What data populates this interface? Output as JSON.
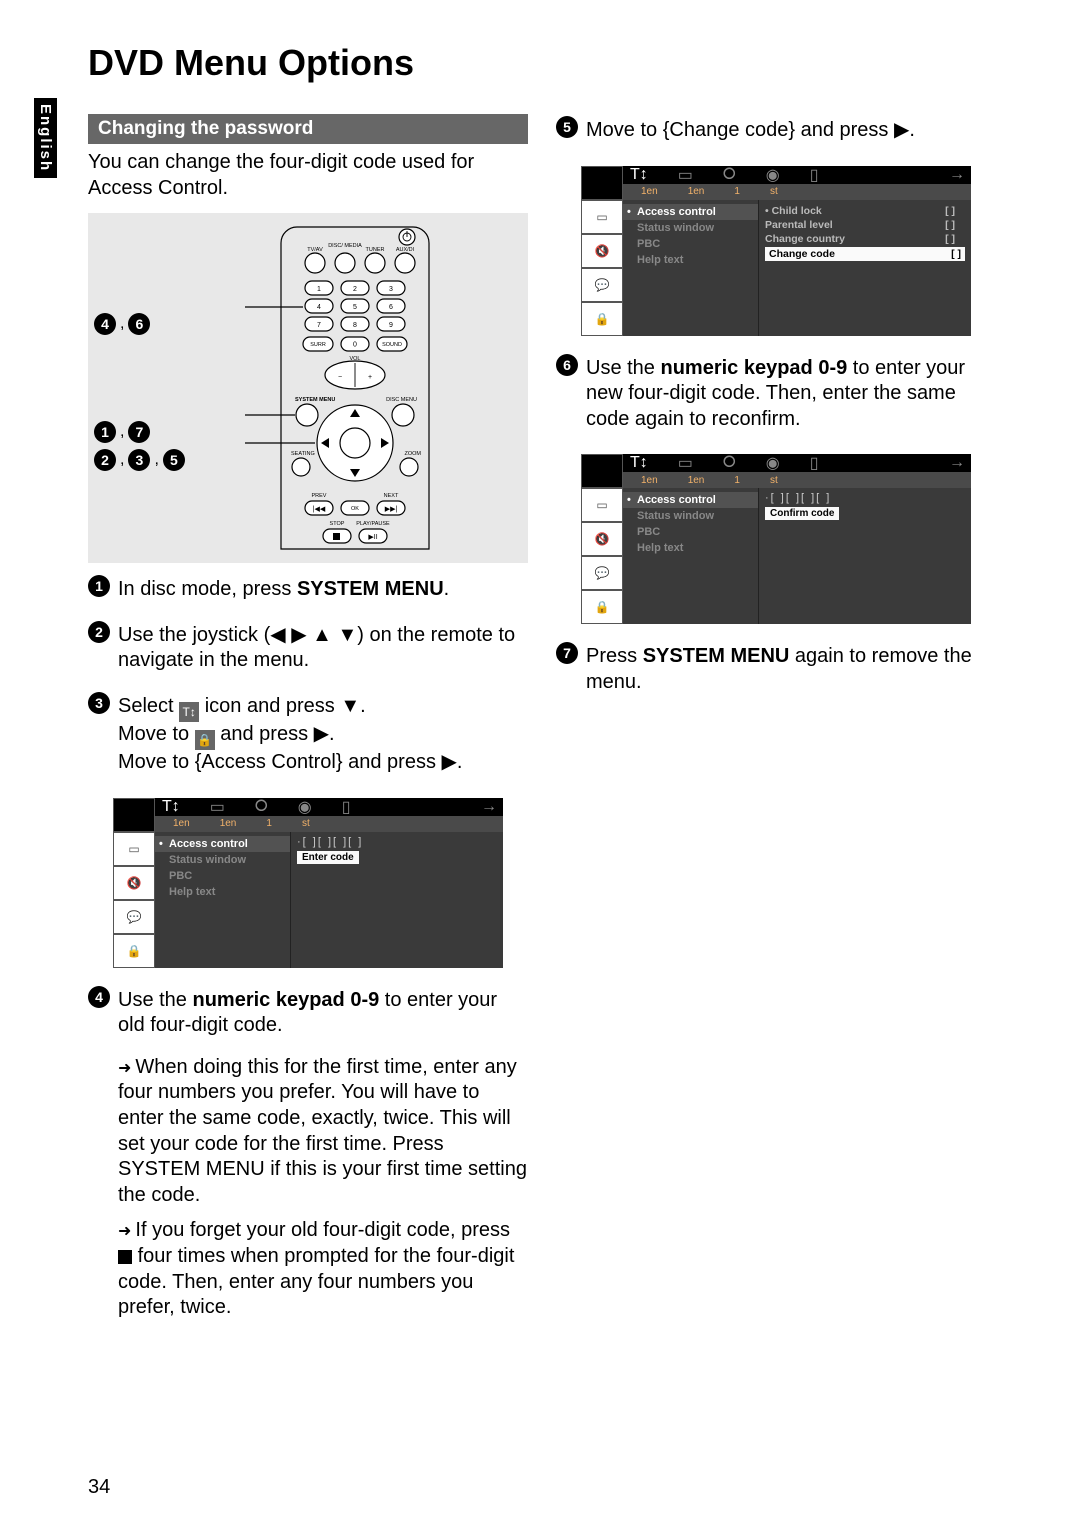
{
  "page_number": "34",
  "language_tab": "English",
  "main_heading": "DVD Menu Options",
  "section_heading": "Changing the password",
  "intro_text": "You can change the four-digit code used for Access Control.",
  "remote_callouts": {
    "top": {
      "num1": "4",
      "num2": "6"
    },
    "mid": {
      "num1": "1",
      "num2": "7"
    },
    "bot": {
      "num1": "2",
      "num2": "3",
      "num3": "5"
    }
  },
  "remote_labels": {
    "row1": "TV/AV",
    "row1b": "DISC/\nMEDIA",
    "row1c": "TUNER",
    "row1d": "AUX/DI",
    "surr": "SURR",
    "sound": "SOUND",
    "vol": "VOL",
    "sysmenu": "SYSTEM MENU",
    "discmenu": "DISC MENU",
    "seating": "SEATING",
    "zoom": "ZOOM",
    "prev": "PREV",
    "next": "NEXT",
    "ok": "OK",
    "stop": "STOP",
    "play": "PLAY/PAUSE"
  },
  "steps": {
    "s1": "In disc mode, press ",
    "s1b": "SYSTEM MENU",
    "s1c": ".",
    "s2": "Use the joystick (◀ ▶ ▲ ▼) on the remote to navigate in the menu.",
    "s3a": "Select ",
    "s3b": " icon and press ▼.",
    "s3c1": "Move to ",
    "s3c2": " and press ▶.",
    "s3d": "Move to {Access Control} and press ▶.",
    "s4a": "Use the ",
    "s4b": "numeric keypad 0-9",
    "s4c": " to enter your old four-digit code.",
    "s4n1": "When doing this for the first time, enter any four numbers you prefer. You will have to enter the same code, exactly, twice.  This will set your code for the first time.  Press SYSTEM MENU if this is your first time setting the code.",
    "s4n2a": "If you forget your old four-digit code, press ",
    "s4n2b": " four times when prompted for the four-digit code.  Then, enter any four numbers you prefer, twice.",
    "s5": "Move to {Change code} and press ▶.",
    "s6a": "Use the ",
    "s6b": "numeric keypad 0-9",
    "s6c": " to enter your new four-digit code.  Then, enter the same code again to reconfirm.",
    "s7a": "Press ",
    "s7b": "SYSTEM MENU",
    "s7c": " again to remove the menu."
  },
  "osd": {
    "sub": [
      "1en",
      "1en",
      "1",
      "st"
    ],
    "list": [
      "Access control",
      "Status window",
      "PBC",
      "Help text"
    ],
    "enter_digits": "·[  ][  ][  ][  ]",
    "enter_code": "Enter code",
    "confirm_code": "Confirm code",
    "opts": [
      "Child lock",
      "Parental level",
      "Change country",
      "Change code"
    ],
    "brk": "[   ]"
  }
}
